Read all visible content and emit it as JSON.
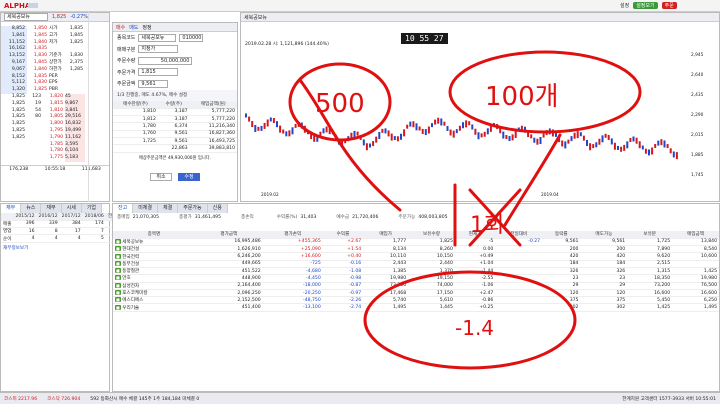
{
  "app": {
    "logo": "ALPHA",
    "window_title": " ",
    "menu": [
      "설정",
      "트레이딩",
      "바로가기",
      "W크로",
      "화면보기"
    ],
    "green_btn": "설정보기",
    "red_btn": "주문"
  },
  "stock": {
    "name": "세북공보뉴",
    "price": "1,825",
    "change": "-0.27%",
    "volume": "거래량228,541",
    "pct": "16.90%"
  },
  "orderbook": {
    "asks": [
      [
        "8,852",
        "1,850",
        "시가",
        "1,835"
      ],
      [
        "1,841",
        "1,845",
        "고가",
        "1,845"
      ],
      [
        "11,152",
        "1,840",
        "저가",
        "1,825"
      ],
      [
        "16,162",
        "1,835",
        "",
        ""
      ],
      [
        "13,152",
        "1,830",
        "기준가",
        "1,830"
      ],
      [
        "9,167",
        "1,845",
        "상한가",
        "2,375"
      ],
      [
        "9,067",
        "1,840",
        "하한가",
        "1,285"
      ],
      [
        "8,152",
        "1,835",
        "PER",
        ""
      ],
      [
        "5,112",
        "1,830",
        "EPS",
        ""
      ],
      [
        "1,320",
        "1,825",
        "PBR",
        ""
      ]
    ],
    "bids": [
      [
        "1,825",
        "123",
        "1,820",
        "45"
      ],
      [
        "1,825",
        "19",
        "1,815",
        "9,867"
      ],
      [
        "1,825",
        "54",
        "1,810",
        "3,841"
      ],
      [
        "1,825",
        "80",
        "1,805",
        "29,516"
      ],
      [
        "1,825",
        "",
        "1,800",
        "16,832"
      ],
      [
        "1,825",
        "",
        "1,795",
        "19,499"
      ],
      [
        "1,825",
        "",
        "1,790",
        "11,162"
      ],
      [
        "",
        "",
        "1,785",
        "3,595"
      ],
      [
        "",
        "",
        "1,780",
        "6,104"
      ],
      [
        "",
        "",
        "1,775",
        "5,183"
      ]
    ],
    "total_ask": "176,238",
    "time": "10:55:18",
    "total_bid": "111,683"
  },
  "order_form": {
    "title": "주식백문주문",
    "tab_buy": "매수",
    "tab_sell": "매도",
    "tab_modify": "정정",
    "account_label": "종목코드",
    "account_val": "세북공보뉴",
    "code_val": "010000",
    "type_label": "매매구분",
    "type_val": "지정가",
    "price_label": "주문가격",
    "price_val": "1,815",
    "qty_label": "주문수량",
    "qty_val": "50,000,000",
    "amount_label": "주문금액",
    "amount_val": "9,561",
    "summary": "1/3 진행중, 매도 4.67%, 매수 설정",
    "cancel": "취소",
    "submit": "수정",
    "sub_headers": [
      "매수잔량(주)",
      "수량(주)",
      "매입금액(원)"
    ],
    "sub_rows": [
      [
        "1,810",
        "3,187",
        "5,777,220"
      ],
      [
        "1,812",
        "3,187",
        "5,777,220"
      ],
      [
        "1,780",
        "6,374",
        "11,216,340"
      ],
      [
        "1,760",
        "9,561",
        "16,827,360"
      ],
      [
        "1,725",
        "9,561",
        "16,493,725"
      ],
      [
        "",
        "22,863",
        "39,883,810"
      ]
    ],
    "note": "에상주문금액은 49,930,000원 입니다."
  },
  "chart": {
    "title": "세북공보뉴",
    "info": "2019.02.28  시: 1,121,896 (144.40%)",
    "clock": "10 55 27",
    "price_ticks": [
      "2,945",
      "2,640",
      "2,435",
      "2,290",
      "2,015",
      "1,885",
      "1,745"
    ],
    "date_ticks": [
      "2019.02",
      "2019.04"
    ]
  },
  "balance": {
    "tabs": [
      "잔고",
      "미체결",
      "체결",
      "주문가능",
      "신용"
    ],
    "summary": [
      [
        "총매입",
        "21,070,305"
      ],
      [
        "총평가",
        "31,461,495"
      ],
      [
        "총손익",
        ""
      ],
      [
        "수익률(%)",
        "31,403"
      ],
      [
        "예수금",
        "21,720,406"
      ],
      [
        "주문가능",
        "408,003,805"
      ]
    ],
    "headers": [
      "종목명",
      "평가금액",
      "평가손익",
      "수익률",
      "매입가",
      "보유수량",
      "현재가",
      "전일대비",
      "등락률",
      "매도가능",
      "보유분",
      "매입금액"
    ],
    "rows": [
      [
        "세북공보뉴",
        "16,995,486",
        "+455,365",
        "+2.67",
        "1,777",
        "1,825",
        "-5",
        "-0.27",
        "9,561",
        "9,561",
        "1,725",
        "13,840"
      ],
      [
        "현대건설",
        "1,626,910",
        "+25,090",
        "+1.54",
        "8,134",
        "8,260",
        "0.00",
        "",
        "200",
        "200",
        "7,890",
        "8,540"
      ],
      [
        "한국전력",
        "6,246,200",
        "+16,600",
        "+0.40",
        "10,110",
        "10,150",
        "+0.49",
        "",
        "420",
        "420",
        "9,620",
        "10,600"
      ],
      [
        "동부건설",
        "449,665",
        "-725",
        "-0.16",
        "2,443",
        "2,440",
        "+1.04",
        "",
        "184",
        "184",
        "2,515",
        ""
      ],
      [
        "동양철관",
        "451,522",
        "-4,680",
        "-1.08",
        "1,385",
        "1,370",
        "-1.44",
        "",
        "326",
        "326",
        "1,315",
        "1,425"
      ],
      [
        "만호",
        "448,900",
        "-4,450",
        "-0.98",
        "19,980",
        "19,150",
        "-2.55",
        "",
        "23",
        "23",
        "18,350",
        "19,980"
      ],
      [
        "삼성전자",
        "2,164,400",
        "-18,000",
        "-0.87",
        "73,200",
        "74,000",
        "-1.06",
        "",
        "29",
        "29",
        "73,200",
        "76,500"
      ],
      [
        "포스코케미칼",
        "2,096,250",
        "-20,250",
        "-0.97",
        "17,468",
        "17,150",
        "+2.47",
        "",
        "120",
        "120",
        "16,600",
        "16,600"
      ],
      [
        "에스디에스",
        "2,152,500",
        "-48,750",
        "-2.26",
        "5,740",
        "5,610",
        "-0.86",
        "",
        "375",
        "375",
        "5,450",
        "6,250"
      ],
      [
        "우리기술",
        "451,400",
        "-13,100",
        "-2.74",
        "1,495",
        "1,445",
        "+0.25",
        "",
        "302",
        "302",
        "1,425",
        "1,495"
      ]
    ]
  },
  "left_bottom": {
    "tabs": [
      "재무",
      "뉴스",
      "재무",
      "시세",
      "기업"
    ],
    "headers": [
      "",
      "2015/12",
      "2016/12",
      "2017/12",
      "2018/06",
      "전년동기"
    ],
    "rows": [
      [
        "매출",
        "396",
        "339",
        "384",
        "174",
        "202"
      ],
      [
        "영업",
        "16",
        "8",
        "17",
        "7",
        "5"
      ],
      [
        "순이",
        "4",
        "4",
        "4",
        "5",
        "4"
      ]
    ],
    "link": "재무정보보기"
  },
  "annotations": [
    "500",
    "100개",
    "1회",
    "-1.4"
  ],
  "status": {
    "index": "코스피 2217.96",
    "kosdaq": "코스닥 726.904",
    "msg": "592 동화산시 매수 체결 145주 1주 184,184 미체결 0",
    "right": "한계지원  고객센터 1577-3933  서버 10:55:01"
  }
}
